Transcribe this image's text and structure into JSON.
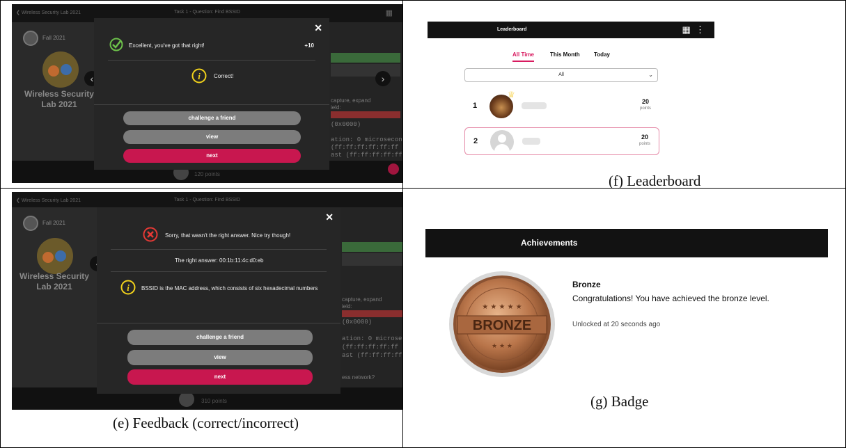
{
  "panel_correct": {
    "topbar_back": "Wireless Security Lab 2021",
    "topbar_title": "Task 1 - Question: Find BSSID",
    "semester": "Fall 2021",
    "course_title": "Wireless Security Lab 2021",
    "bg_lines": [
      "capture, expand",
      "ield:",
      "(0x0000)",
      "ation: 0 microseconds",
      "(ff:ff:ff:ff:ff:ff",
      "ast (ff:ff:ff:ff:ff"
    ],
    "bottom_points": "120 points",
    "modal": {
      "result_text": "Excellent, you've got that right!",
      "score": "+10",
      "info_text": "Correct!",
      "buttons": {
        "challenge": "challenge a friend",
        "view": "view",
        "next": "next"
      }
    }
  },
  "panel_incorrect": {
    "topbar_back": "Wireless Security Lab 2021",
    "topbar_title": "Task 1 - Question: Find BSSID",
    "semester": "Fall 2021",
    "course_title": "Wireless Security Lab 2021",
    "bg_lines": [
      "capture, expand",
      "ield:",
      "(0x0000)",
      "ation: 0 microseconds",
      "(ff:ff:ff:ff:ff",
      "ast (ff:ff:ff:ff:f"
    ],
    "bg_question": "ess network?",
    "bottom_points": "310 points",
    "modal": {
      "result_text": "Sorry, that wasn't the right answer. Nice try though!",
      "right_answer": "The right answer: 00:1b:11:4c:d0:eb",
      "info_text": "BSSID is the MAC address, which consists of six hexadecimal numbers",
      "buttons": {
        "challenge": "challenge a friend",
        "view": "view",
        "next": "next"
      }
    }
  },
  "leaderboard": {
    "title": "Leaderboard",
    "tabs": [
      "All Time",
      "This Month",
      "Today"
    ],
    "active_tab": "All Time",
    "filter_value": "All",
    "rows": [
      {
        "rank": "1",
        "points": "20",
        "unit": "points"
      },
      {
        "rank": "2",
        "points": "20",
        "unit": "points"
      }
    ]
  },
  "achievements": {
    "title": "Achievements",
    "badge_label": "BRONZE",
    "badge_name": "Bronze",
    "badge_desc": "Congratulations! You have achieved the bronze level.",
    "unlocked": "Unlocked at 20 seconds ago"
  },
  "captions": {
    "f": "(f) Leaderboard",
    "e": "(e) Feedback (correct/incorrect)",
    "g": "(g) Badge"
  },
  "colors": {
    "accent_pink": "#c8174f",
    "success_green": "#6cc04a",
    "error_red": "#e53935",
    "info_yellow": "#f2d21b",
    "bronze": "#b9754a"
  }
}
